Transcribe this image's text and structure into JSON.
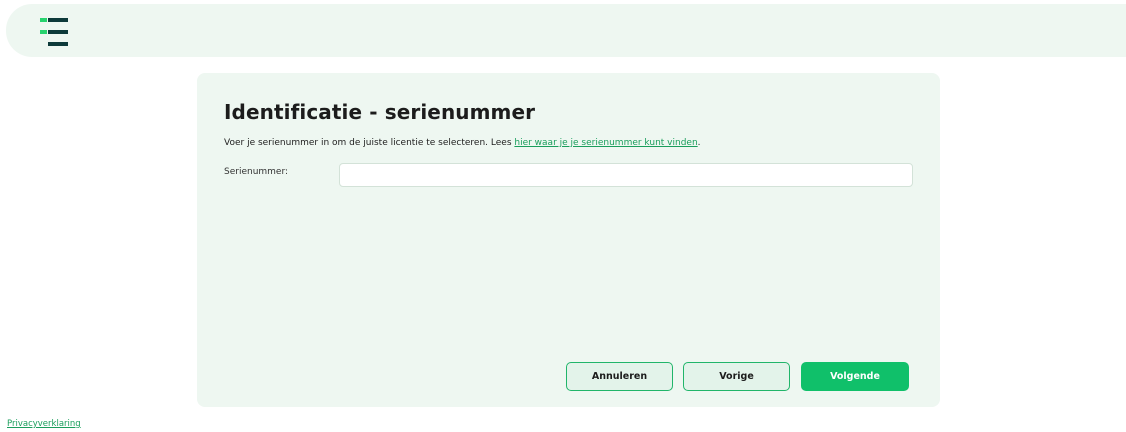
{
  "header": {
    "logo_icon": "menu-lines-logo-icon",
    "colors": {
      "logo_green": "#27d36e",
      "logo_dark": "#0d3a3a",
      "background": "#eef7f1"
    }
  },
  "form": {
    "title": "Identificatie - serienummer",
    "intro_text": "Voer je serienummer in om de juiste licentie te selecteren. Lees ",
    "intro_link": "hier waar je je serienummer kunt vinden",
    "intro_end": ".",
    "serial_label": "Serienummer:",
    "serial_value": "",
    "serial_placeholder": ""
  },
  "buttons": {
    "cancel": "Annuleren",
    "previous": "Vorige",
    "next": "Volgende"
  },
  "footer": {
    "privacy_link": "Privacyverklaring"
  },
  "colors": {
    "accent": "#10c06a",
    "link": "#1a9e5c",
    "card_background": "#eef7f1"
  }
}
